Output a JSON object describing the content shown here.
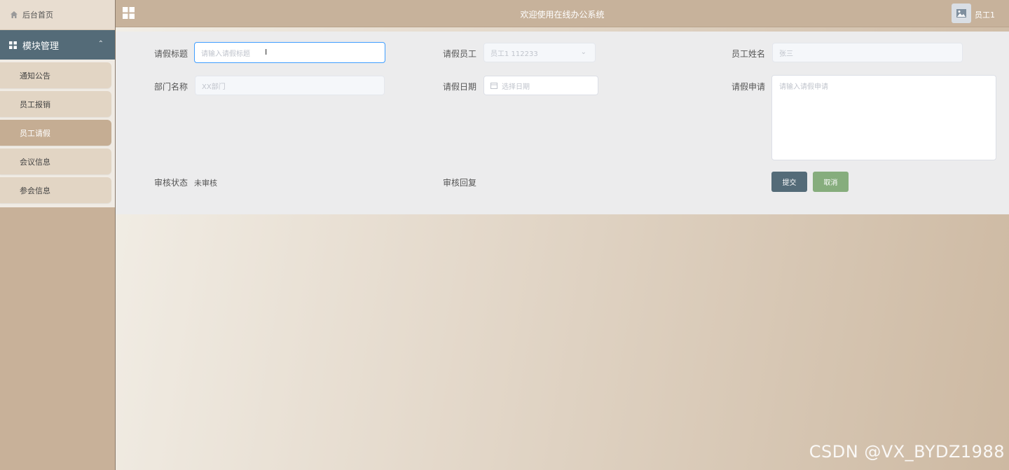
{
  "sidebar": {
    "home_label": "后台首页",
    "module_label": "模块管理",
    "items": [
      {
        "label": "通知公告"
      },
      {
        "label": "员工报销"
      },
      {
        "label": "员工请假"
      },
      {
        "label": "会议信息"
      },
      {
        "label": "参会信息"
      }
    ]
  },
  "header": {
    "title": "欢迎使用在线办公系统",
    "username": "员工1"
  },
  "form": {
    "leave_title": {
      "label": "请假标题",
      "placeholder": "请输入请假标题"
    },
    "leave_employee": {
      "label": "请假员工",
      "value": "员工1 112233"
    },
    "employee_name": {
      "label": "员工姓名",
      "value": "张三"
    },
    "department": {
      "label": "部门名称",
      "value": "XX部门"
    },
    "leave_date": {
      "label": "请假日期",
      "placeholder": "选择日期"
    },
    "leave_request": {
      "label": "请假申请",
      "placeholder": "请输入请假申请"
    },
    "review_status": {
      "label": "审核状态",
      "value": "未审核"
    },
    "review_reply": {
      "label": "审核回复",
      "value": ""
    },
    "submit_label": "提交",
    "cancel_label": "取消"
  },
  "watermark": "CSDN @VX_BYDZ1988",
  "colors": {
    "sidebar_bg": "#c8b199",
    "module_header": "#546b78",
    "active_item": "#c5ad93",
    "submit_button": "#546b78",
    "cancel_button": "#86ad7d",
    "focus_border": "#409eff"
  }
}
